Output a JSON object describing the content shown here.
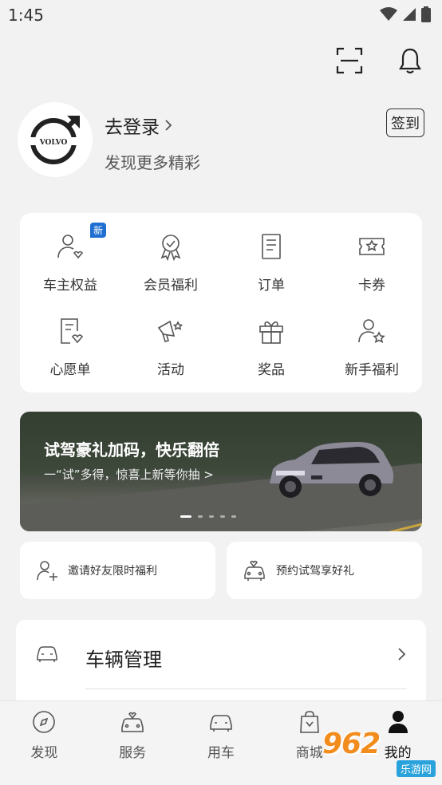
{
  "status_bar": {
    "time": "1:45"
  },
  "profile": {
    "login_text": "去登录",
    "subtitle": "发现更多精彩",
    "signin_label": "签到",
    "logo_text": "VOLVO"
  },
  "grid": {
    "items": [
      {
        "label": "车主权益",
        "icon": "owner-benefits-icon",
        "badge": "新"
      },
      {
        "label": "会员福利",
        "icon": "member-award-icon"
      },
      {
        "label": "订单",
        "icon": "order-icon"
      },
      {
        "label": "卡券",
        "icon": "coupon-icon"
      },
      {
        "label": "心愿单",
        "icon": "wishlist-icon"
      },
      {
        "label": "活动",
        "icon": "activity-icon"
      },
      {
        "label": "奖品",
        "icon": "gift-icon"
      },
      {
        "label": "新手福利",
        "icon": "newbie-benefits-icon"
      }
    ]
  },
  "banner": {
    "title": "试驾豪礼加码，快乐翻倍",
    "subtitle": "一“试”多得，惊喜上新等你抽 >",
    "slide_count": 5,
    "active_slide": 0
  },
  "promos": [
    {
      "label": "邀请好友限时福利",
      "icon": "invite-friend-icon"
    },
    {
      "label": "预约试驾享好礼",
      "icon": "test-drive-icon"
    }
  ],
  "vehicle_card": {
    "title": "车辆管理",
    "icon": "car-icon"
  },
  "tabs": [
    {
      "label": "发现",
      "icon": "compass-icon",
      "active": false
    },
    {
      "label": "服务",
      "icon": "service-car-icon",
      "active": false
    },
    {
      "label": "用车",
      "icon": "car-icon",
      "active": false
    },
    {
      "label": "商城",
      "icon": "shopping-bag-icon",
      "active": false
    },
    {
      "label": "我的",
      "icon": "person-icon",
      "active": true
    }
  ],
  "watermark": {
    "big": "962",
    "small": "乐游网"
  },
  "colors": {
    "badge": "#1f6fd1",
    "background": "#f2f2f2",
    "card": "#ffffff",
    "watermark": "#f28c1d"
  }
}
